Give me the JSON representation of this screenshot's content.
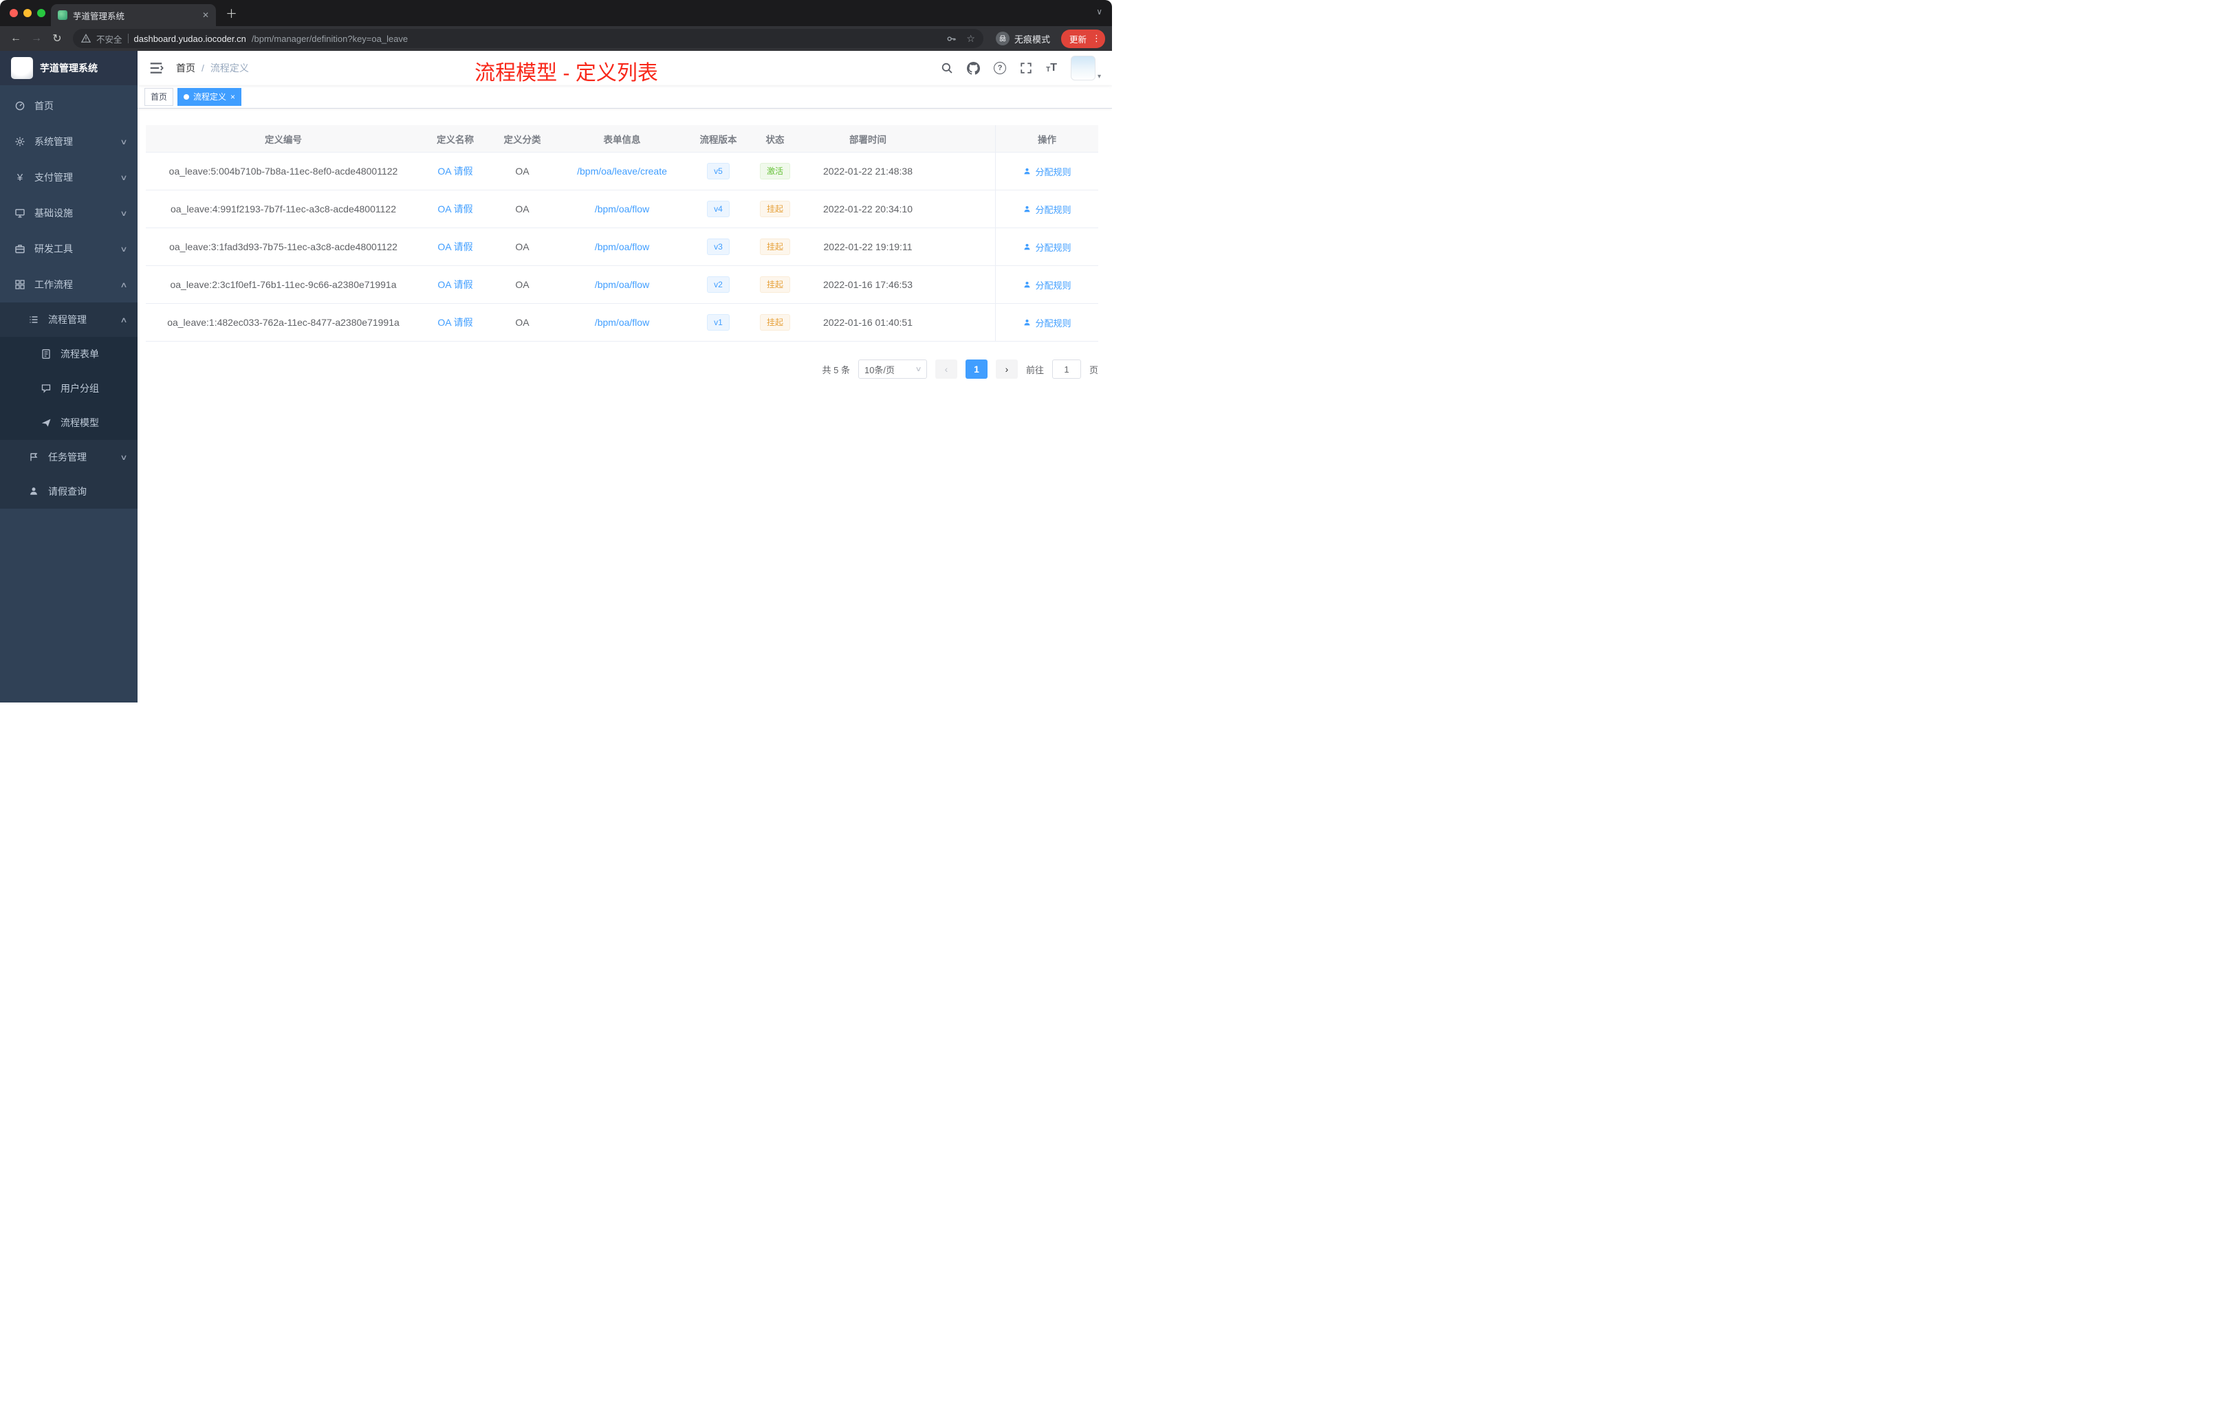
{
  "colors": {
    "accent": "#409eff",
    "success": "#67c23a",
    "warning": "#e6a23c",
    "annotation_red": "#f8281a",
    "sidebar_bg": "#304156"
  },
  "browser": {
    "tab_title": "芋道管理系统",
    "security_label": "不安全",
    "url_host": "dashboard.yudao.iocoder.cn",
    "url_path": "/bpm/manager/definition?key=oa_leave",
    "incognito_label": "无痕模式",
    "update_label": "更新"
  },
  "icons": {
    "close": "✕",
    "tag_close": "×",
    "plus": "＋",
    "back": "←",
    "forward": "→",
    "reload": "↻",
    "star": "☆",
    "kebab": "⋮",
    "chevron_down": "∨",
    "chevron_up": "∧",
    "avatar_caret": "▾",
    "question_mark": "?",
    "text_small": "T",
    "text_large": "T",
    "yen": "¥",
    "prev": "‹",
    "next": "›"
  },
  "sidebar": {
    "logo_title": "芋道管理系统",
    "items": [
      {
        "label": "首页"
      },
      {
        "label": "系统管理"
      },
      {
        "label": "支付管理"
      },
      {
        "label": "基础设施"
      },
      {
        "label": "研发工具"
      },
      {
        "label": "工作流程"
      },
      {
        "label": "流程管理"
      },
      {
        "label": "流程表单"
      },
      {
        "label": "用户分组"
      },
      {
        "label": "流程模型"
      },
      {
        "label": "任务管理"
      },
      {
        "label": "请假查询"
      }
    ]
  },
  "header": {
    "breadcrumb_home": "首页",
    "breadcrumb_sep": "/",
    "breadcrumb_current": "流程定义",
    "annotation": "流程模型 - 定义列表"
  },
  "tags": {
    "home": "首页",
    "current": "流程定义"
  },
  "table": {
    "columns": {
      "id": "定义编号",
      "name": "定义名称",
      "category": "定义分类",
      "form": "表单信息",
      "version": "流程版本",
      "status": "状态",
      "deploy_time": "部署时间",
      "ops": "操作"
    },
    "action_label": "分配规则",
    "rows": [
      {
        "id": "oa_leave:5:004b710b-7b8a-11ec-8ef0-acde48001122",
        "name": "OA 请假",
        "category": "OA",
        "form": "/bpm/oa/leave/create",
        "version": "v5",
        "status": "激活",
        "time": "2022-01-22 21:48:38"
      },
      {
        "id": "oa_leave:4:991f2193-7b7f-11ec-a3c8-acde48001122",
        "name": "OA 请假",
        "category": "OA",
        "form": "/bpm/oa/flow",
        "version": "v4",
        "status": "挂起",
        "time": "2022-01-22 20:34:10"
      },
      {
        "id": "oa_leave:3:1fad3d93-7b75-11ec-a3c8-acde48001122",
        "name": "OA 请假",
        "category": "OA",
        "form": "/bpm/oa/flow",
        "version": "v3",
        "status": "挂起",
        "time": "2022-01-22 19:19:11"
      },
      {
        "id": "oa_leave:2:3c1f0ef1-76b1-11ec-9c66-a2380e71991a",
        "name": "OA 请假",
        "category": "OA",
        "form": "/bpm/oa/flow",
        "version": "v2",
        "status": "挂起",
        "time": "2022-01-16 17:46:53"
      },
      {
        "id": "oa_leave:1:482ec033-762a-11ec-8477-a2380e71991a",
        "name": "OA 请假",
        "category": "OA",
        "form": "/bpm/oa/flow",
        "version": "v1",
        "status": "挂起",
        "time": "2022-01-16 01:40:51"
      }
    ]
  },
  "pagination": {
    "total": "共 5 条",
    "page_size": "10条/页",
    "current": "1",
    "goto": "前往",
    "goto_value": "1",
    "unit": "页"
  }
}
